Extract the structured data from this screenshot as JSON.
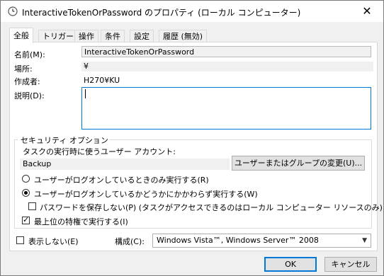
{
  "window": {
    "title": "InteractiveTokenOrPassword のプロパティ (ローカル コンピューター)",
    "close_glyph": "✕"
  },
  "tabs": [
    {
      "label": "全般",
      "active": true
    },
    {
      "label": "トリガー",
      "active": false
    },
    {
      "label": "操作",
      "active": false
    },
    {
      "label": "条件",
      "active": false
    },
    {
      "label": "設定",
      "active": false
    },
    {
      "label": "履歴 (無効)",
      "active": false
    }
  ],
  "general": {
    "name_label": "名前(M):",
    "name_value": "InteractiveTokenOrPassword",
    "location_label": "場所:",
    "location_value": "¥",
    "author_label": "作成者:",
    "author_value": "H270¥KU",
    "description_label": "説明(D):",
    "description_value": ""
  },
  "security": {
    "group_label": "セキュリティ オプション",
    "account_prompt": "タスクの実行時に使うユーザー アカウント:",
    "account_value": "Backup",
    "change_user_button": "ユーザーまたはグループの変更(U)...",
    "radio_logged_on_only": "ユーザーがログオンしているときのみ実行する(R)",
    "radio_whether_logged_on": "ユーザーがログオンしているかどうかにかかわらず実行する(W)",
    "selected_radio": "whether_logged_on",
    "no_store_password": "パスワードを保存しない(P) (タスクがアクセスできるのはローカル コンピューター リソースのみ)",
    "no_store_password_checked": false,
    "highest_privileges": "最上位の特権で実行する(I)",
    "highest_privileges_checked": true
  },
  "footer": {
    "hidden_label": "表示しない(E)",
    "hidden_checked": false,
    "configure_label": "構成(C):",
    "configure_value": "Windows Vista™, Windows Server™ 2008",
    "ok_button": "OK",
    "cancel_button": "キャンセル"
  }
}
